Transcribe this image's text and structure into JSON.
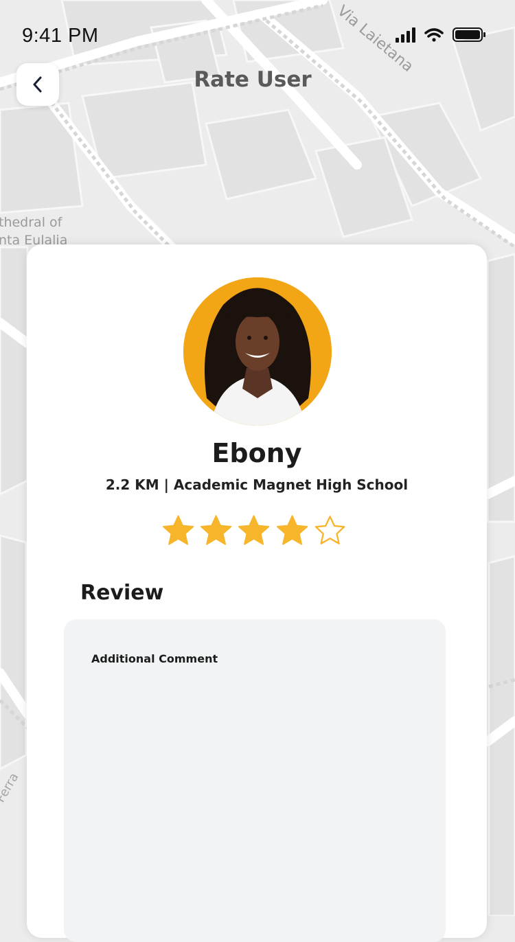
{
  "status_bar": {
    "time": "9:41 PM"
  },
  "header": {
    "title": "Rate User"
  },
  "map": {
    "street_label": "Via Laietana",
    "poi_line1": "thedral of",
    "poi_line2": "nta Eulalia",
    "street_label_2": "Ferra"
  },
  "user": {
    "name": "Ebony",
    "meta": "2.2 KM | Academic Magnet High School",
    "rating": 4,
    "max_rating": 5
  },
  "review": {
    "section_title": "Review",
    "comment_label": "Additional Comment",
    "comment_value": ""
  },
  "colors": {
    "star_fill": "#f7b52b",
    "avatar_bg": "#f2a615",
    "field_bg": "#f1f3f4"
  }
}
